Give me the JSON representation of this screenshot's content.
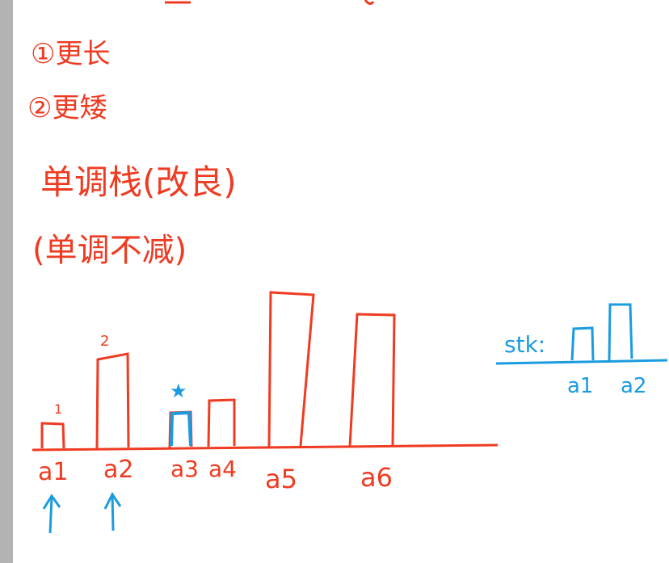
{
  "notes": {
    "item1": "①更长",
    "item2": "②更矮",
    "method": "单调栈(改良)",
    "method_alt": "(单调不减)"
  },
  "bars": {
    "labels": [
      "a1",
      "a2",
      "a3",
      "a4",
      "a5",
      "a6"
    ],
    "markers": [
      "1",
      "2",
      "",
      "",
      "",
      ""
    ],
    "highlight_mark": "★"
  },
  "stack_panel": {
    "label": "stk:",
    "labels": [
      "a1",
      "a2"
    ]
  },
  "colors": {
    "red": "#ef3b22",
    "blue": "#1b9be0",
    "gray": "#b3b3b3"
  }
}
